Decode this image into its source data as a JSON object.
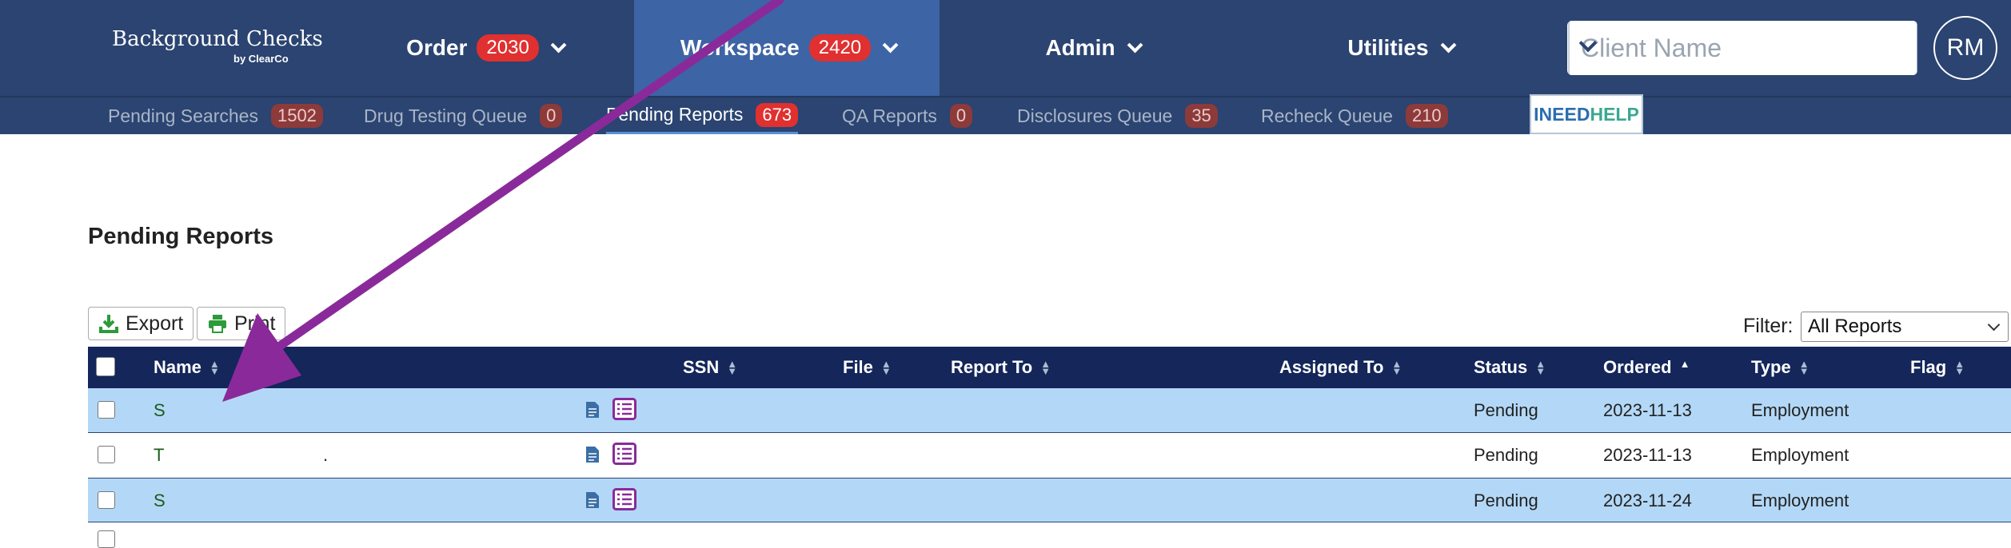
{
  "brand": {
    "name": "Background Checks",
    "sub": "by ClearCo"
  },
  "nav": [
    {
      "label": "Order",
      "badge": "2030"
    },
    {
      "label": "Workspace",
      "badge": "2420"
    },
    {
      "label": "Admin",
      "badge": null
    },
    {
      "label": "Utilities",
      "badge": null
    }
  ],
  "search": {
    "placeholder": "Client Name"
  },
  "user": {
    "initials": "RM"
  },
  "subnav": [
    {
      "label": "Pending Searches",
      "badge": "1502"
    },
    {
      "label": "Drug Testing Queue",
      "badge": "0"
    },
    {
      "label": "Pending Reports",
      "badge": "673"
    },
    {
      "label": "QA Reports",
      "badge": "0"
    },
    {
      "label": "Disclosures Queue",
      "badge": "35"
    },
    {
      "label": "Recheck Queue",
      "badge": "210"
    }
  ],
  "help": {
    "part1": "INEED",
    "part2": "HELP"
  },
  "page": {
    "title": "Pending Reports"
  },
  "toolbar": {
    "export": "Export",
    "print": "Print"
  },
  "filter": {
    "label": "Filter:",
    "value": "All Reports"
  },
  "table": {
    "headers": {
      "name": "Name",
      "ssn": "SSN",
      "file": "File",
      "report_to": "Report To",
      "assigned_to": "Assigned To",
      "status": "Status",
      "ordered": "Ordered",
      "type": "Type",
      "flag": "Flag"
    },
    "rows": [
      {
        "name": "S",
        "extra": "",
        "status": "Pending",
        "ordered": "2023-11-13",
        "type": "Employment"
      },
      {
        "name": "T",
        "extra": ".",
        "status": "Pending",
        "ordered": "2023-11-13",
        "type": "Employment"
      },
      {
        "name": "S",
        "extra": "",
        "status": "Pending",
        "ordered": "2023-11-24",
        "type": "Employment"
      }
    ]
  },
  "colors": {
    "nav_bg": "#2b4471",
    "active_nav": "#3d64a5",
    "badge": "#e03030",
    "header_bg": "#14265a",
    "row_alt": "#b3d8f7",
    "annotation_arrow": "#8a2a9a"
  }
}
